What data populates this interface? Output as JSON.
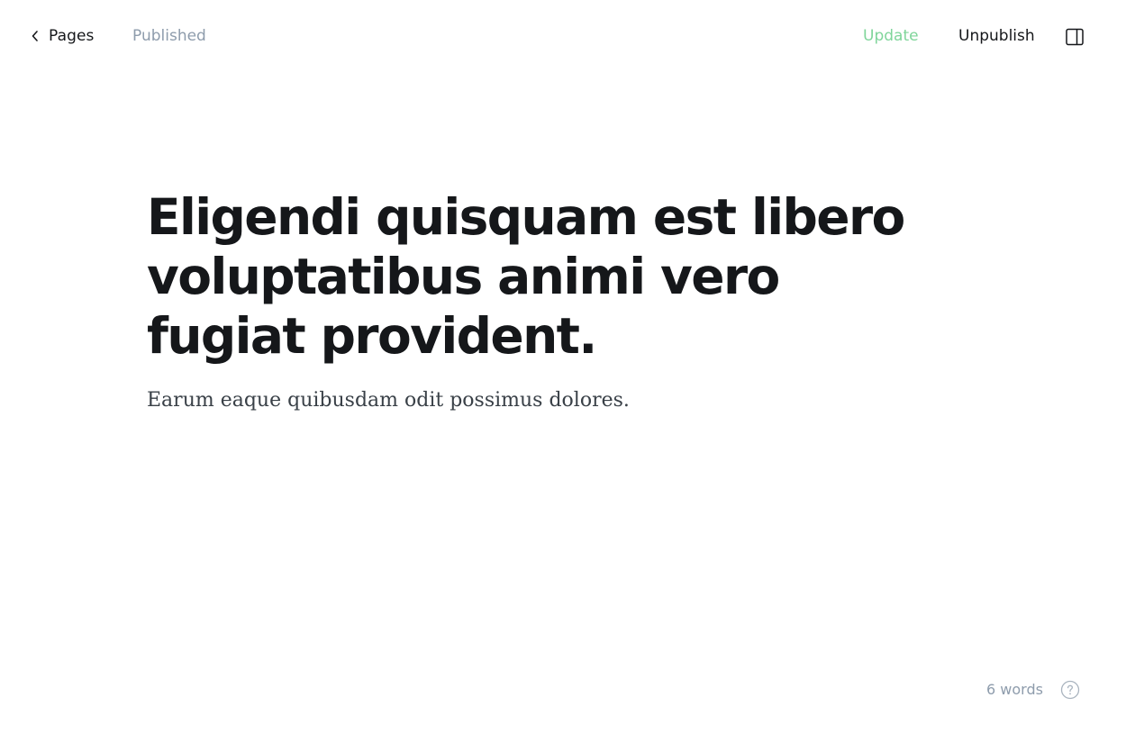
{
  "header": {
    "back_label": "Pages",
    "back_icon": "chevron-left-icon",
    "status": "Published",
    "update_label": "Update",
    "unpublish_label": "Unpublish",
    "sidebar_toggle_icon": "sidebar-panel-icon"
  },
  "post": {
    "title": "Eligendi quisquam est libero voluptatibus animi vero fugiat provident.",
    "excerpt": "Earum eaque quibusdam odit possimus dolores."
  },
  "footer": {
    "word_count": "6 words",
    "help_icon": "question-mark-icon"
  },
  "colors": {
    "text": "#15171a",
    "muted": "#8e9cac",
    "accent_green": "#7fd59a",
    "background": "#ffffff"
  }
}
